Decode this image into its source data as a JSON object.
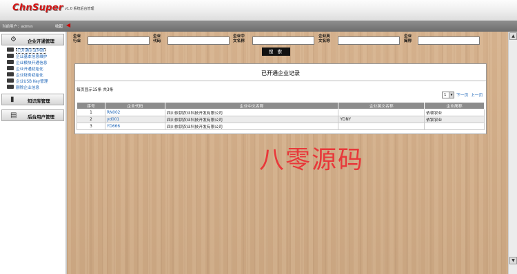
{
  "header": {
    "logo": "ChnSuper",
    "version": "v1.0 系统后台管理"
  },
  "subheader": {
    "current_user": "当前用户：admin",
    "hide_label": "收起"
  },
  "sidebar": {
    "sections": [
      {
        "label": "企业开通管理",
        "icon": "gear-icon"
      },
      {
        "label": "知识库管理",
        "icon": "book-icon"
      },
      {
        "label": "后台用户管理",
        "icon": "user-card-icon"
      }
    ],
    "items": [
      "已开通企业列表",
      "企业基本信息维护",
      "企业模块开通信息",
      "企业开通初始化",
      "企业财务初始化",
      "企业USB Key管理",
      "删除企业信息"
    ]
  },
  "search": {
    "fields": [
      {
        "label_line1": "企业",
        "label_line2": "行业",
        "value": ""
      },
      {
        "label_line1": "企业",
        "label_line2": "代码",
        "value": ""
      },
      {
        "label_line1": "企业中",
        "label_line2": "文名称",
        "value": ""
      },
      {
        "label_line1": "企业英",
        "label_line2": "文名称",
        "value": ""
      },
      {
        "label_line1": "企业",
        "label_line2": "简称",
        "value": ""
      }
    ],
    "button_label": "搜 索"
  },
  "results": {
    "title": "已开通企业记录",
    "page_info": "每页显示15条   共3条",
    "page_select_value": "1",
    "next_label": "下一页",
    "prev_label": "上一页",
    "columns": [
      "序号",
      "企业代码",
      "企业中文名称",
      "企业英文名称",
      "企业简称"
    ],
    "rows": [
      [
        "1",
        "RN002",
        "四川依钡农业科技开发有限公司",
        "",
        "依顿农业"
      ],
      [
        "2",
        "yd001",
        "四川依钡农业科技开发有限公司",
        "YDNY",
        "依钡农业"
      ],
      [
        "3",
        "YD666",
        "四川依钡农业科技开发有限公司",
        "",
        ""
      ]
    ]
  },
  "watermark": "八零源码",
  "colors": {
    "logo": "#d41414",
    "link": "#1e66b8",
    "watermark": "#e8383a",
    "wood": "#d2ac86"
  }
}
